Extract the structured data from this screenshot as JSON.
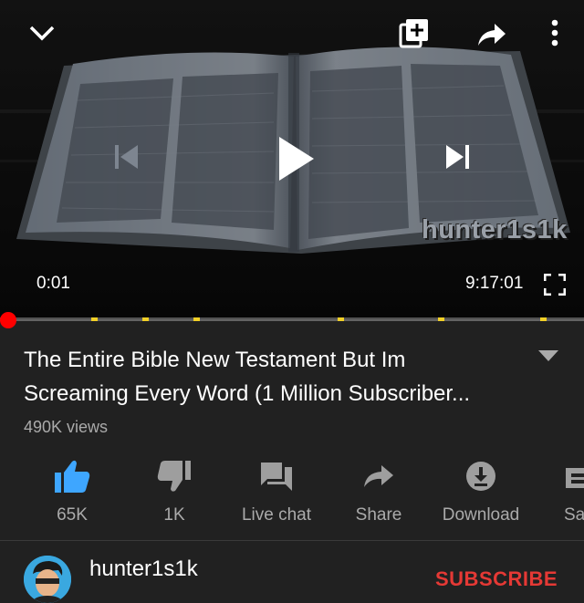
{
  "player": {
    "watermark": "hunter1s1k",
    "current_time": "0:01",
    "total_time": "9:17:01",
    "progress_fraction": 0.0001,
    "chapter_marker_count": 6,
    "controls": {
      "collapse_icon": "chevron-down-icon",
      "add_to_playlist_icon": "add-to-playlist-icon",
      "share_icon": "share-arrow-icon",
      "more_icon": "more-vertical-icon",
      "previous_icon": "skip-previous-icon",
      "play_icon": "play-icon",
      "next_icon": "skip-next-icon",
      "fullscreen_icon": "fullscreen-icon"
    }
  },
  "video": {
    "title_line1": "The Entire Bible New Testament But Im",
    "title_line2": "Screaming Every Word (1 Million Subscriber...",
    "views": "490K views"
  },
  "actions": [
    {
      "label": "65K",
      "icon": "thumbs-up-icon",
      "active": true
    },
    {
      "label": "1K",
      "icon": "thumbs-down-icon",
      "active": false
    },
    {
      "label": "Live chat",
      "icon": "live-chat-icon",
      "active": false
    },
    {
      "label": "Share",
      "icon": "share-icon",
      "active": false
    },
    {
      "label": "Download",
      "icon": "download-icon",
      "active": false
    },
    {
      "label": "Sa",
      "icon": "save-icon",
      "active": false
    }
  ],
  "channel": {
    "name": "hunter1s1k",
    "subscribe_label": "SUBSCRIBE"
  },
  "colors": {
    "background": "#212121",
    "accent_like": "#3ea6ff",
    "progress_red": "#ff0000",
    "chapter_yellow": "#f2d027",
    "subscribe_red": "#e53935",
    "secondary_text": "#aaaaaa"
  }
}
